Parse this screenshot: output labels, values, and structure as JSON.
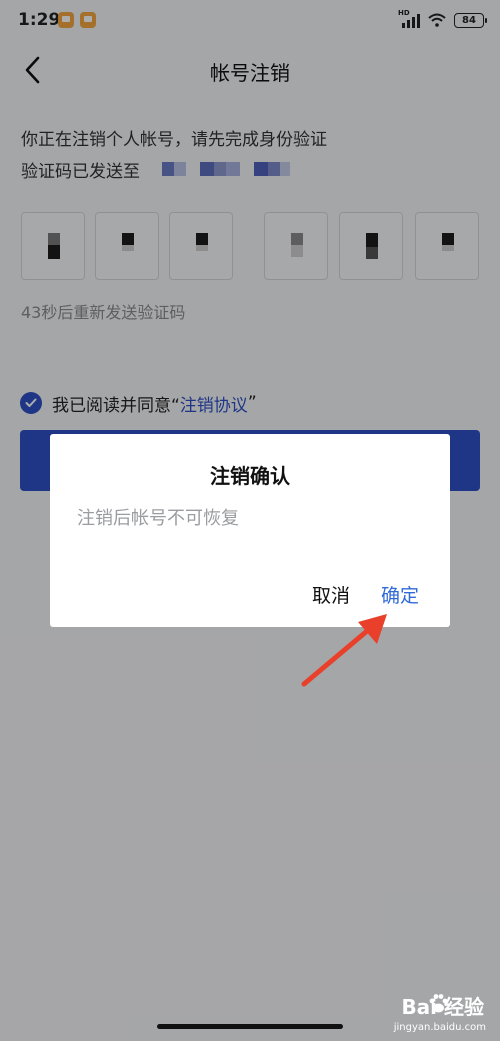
{
  "status_bar": {
    "time": "1:29",
    "network_label": "HD",
    "battery_level": "84"
  },
  "nav": {
    "title": "帐号注销"
  },
  "verify": {
    "intro": "你正在注销个人帐号，请先完成身份验证",
    "sent_label": "验证码已发送至",
    "resend_text": "43秒后重新发送验证码"
  },
  "agreement": {
    "prefix": "我已阅读并同意“",
    "link": "注销协议",
    "suffix": "”"
  },
  "dialog": {
    "title": "注销确认",
    "message": "注销后帐号不可恢复",
    "cancel": "取消",
    "confirm": "确定"
  },
  "watermark": {
    "logo": "Bai  经验",
    "url": "jingyan.baidu.com"
  },
  "colors": {
    "accent": "#2f50c8",
    "dialog_confirm": "#2f6ad8",
    "arrow": "#e8402a",
    "overlay": "rgba(0,0,0,0.32)"
  }
}
